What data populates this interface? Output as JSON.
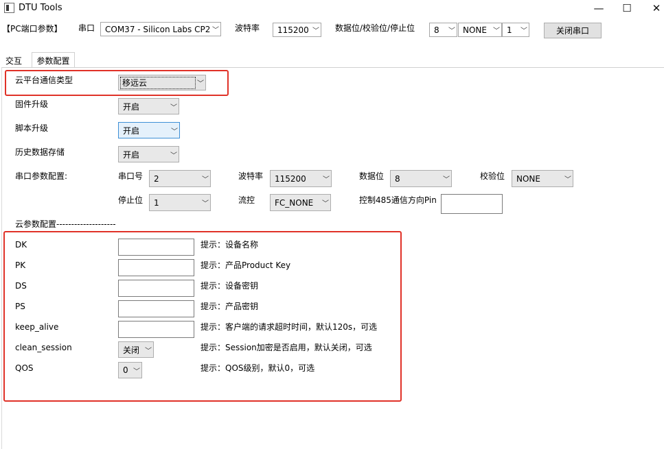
{
  "window": {
    "title": "DTU Tools",
    "minimize": "—",
    "maximize": "☐",
    "close": "✕"
  },
  "portbar": {
    "section_label": "【PC端口参数】",
    "port_label": "串口",
    "port_value": "COM37 - Silicon Labs CP2",
    "baud_label": "波特率",
    "baud_value": "115200",
    "dps_label": "数据位/校验位/停止位",
    "databits_value": "8",
    "parity_value": "NONE",
    "stopbits_value": "1",
    "close_button": "关闭串口"
  },
  "tabs": [
    {
      "label": "交互"
    },
    {
      "label": "参数配置"
    }
  ],
  "config": {
    "cloud_type": {
      "label": "云平台通信类型",
      "value": "移远云"
    },
    "firmware": {
      "label": "固件升级",
      "value": "开启"
    },
    "script": {
      "label": "脚本升级",
      "value": "开启"
    },
    "history": {
      "label": "历史数据存储",
      "value": "开启"
    },
    "serial": {
      "label": "串口参数配置:",
      "port_no_label": "串口号",
      "port_no_value": "2",
      "baud_label": "波特率",
      "baud_value": "115200",
      "databits_label": "数据位",
      "databits_value": "8",
      "parity_label": "校验位",
      "parity_value": "NONE",
      "stopbits_label": "停止位",
      "stopbits_value": "1",
      "flow_label": "流控",
      "flow_value": "FC_NONE",
      "pin_label": "控制485通信方向Pin",
      "pin_value": ""
    }
  },
  "cloud": {
    "header": "云参数配置--------------------",
    "dk": {
      "label": "DK",
      "value": "",
      "hint": "提示：设备名称"
    },
    "pk": {
      "label": "PK",
      "value": "",
      "hint": "提示：产品Product Key"
    },
    "ds": {
      "label": "DS",
      "value": "",
      "hint": "提示：设备密钥"
    },
    "ps": {
      "label": "PS",
      "value": "",
      "hint": "提示：产品密钥"
    },
    "keep_alive": {
      "label": "keep_alive",
      "value": "",
      "hint": "提示：客户端的请求超时时间，默认120s，可选"
    },
    "clean_session": {
      "label": "clean_session",
      "value": "关闭",
      "hint": "提示：Session加密是否启用，默认关闭，可选"
    },
    "qos": {
      "label": "QOS",
      "value": "0",
      "hint": "提示：QOS级别，默认0，可选"
    }
  },
  "icons": {
    "dropdown": "chevron-down-icon",
    "app": "app-icon"
  },
  "colors": {
    "highlight_border": "#e03127",
    "focus_border": "#3d8fd6"
  }
}
